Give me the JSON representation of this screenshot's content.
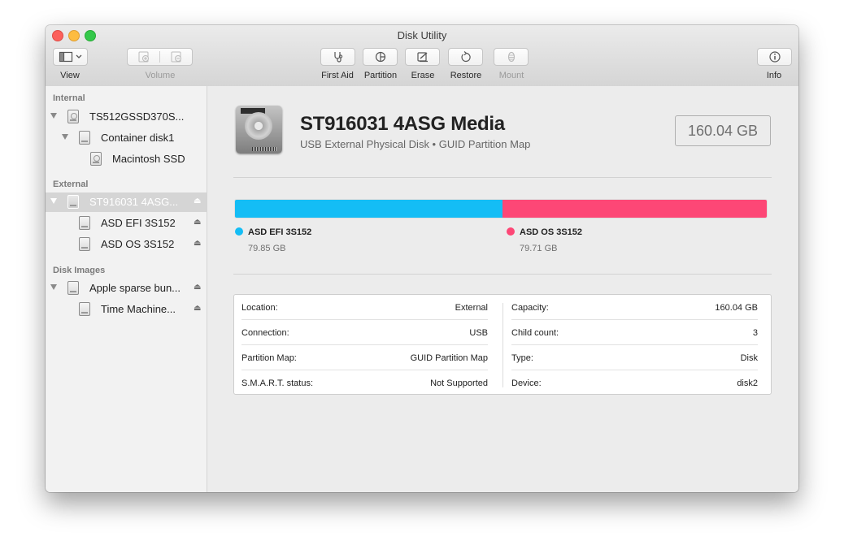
{
  "window": {
    "title": "Disk Utility"
  },
  "toolbar": {
    "view_label": "View",
    "volume_label": "Volume",
    "first_aid_label": "First Aid",
    "partition_label": "Partition",
    "erase_label": "Erase",
    "restore_label": "Restore",
    "mount_label": "Mount",
    "info_label": "Info"
  },
  "sidebar": {
    "sections": [
      {
        "header": "Internal",
        "items": [
          {
            "label": "TS512GSSD370S...",
            "level": 0,
            "icon": "internal-drive-icon",
            "disclosure": true
          },
          {
            "label": "Container disk1",
            "level": 1,
            "icon": "container-icon",
            "disclosure": true
          },
          {
            "label": "Macintosh SSD",
            "level": 2,
            "icon": "volume-icon",
            "disclosure": false
          }
        ]
      },
      {
        "header": "External",
        "items": [
          {
            "label": "ST916031 4ASG...",
            "level": 0,
            "icon": "external-drive-icon",
            "disclosure": true,
            "selected": true,
            "eject": true
          },
          {
            "label": "ASD EFI 3S152",
            "level": 1,
            "icon": "volume-icon",
            "eject": true
          },
          {
            "label": "ASD OS 3S152",
            "level": 1,
            "icon": "volume-icon",
            "eject": true
          }
        ]
      },
      {
        "header": "Disk Images",
        "items": [
          {
            "label": "Apple sparse bun...",
            "level": 0,
            "icon": "disk-image-icon",
            "disclosure": true,
            "eject": true
          },
          {
            "label": "Time Machine...",
            "level": 1,
            "icon": "volume-icon",
            "eject": true
          }
        ]
      }
    ]
  },
  "disk": {
    "name": "ST916031 4ASG Media",
    "subtitle": "USB External Physical Disk • GUID Partition Map",
    "capacity": "160.04 GB"
  },
  "partitions": [
    {
      "name": "ASD EFI 3S152",
      "size": "79.85 GB",
      "fraction": 0.5023,
      "color": "#14bdf5"
    },
    {
      "name": "ASD OS 3S152",
      "size": "79.71 GB",
      "fraction": 0.4977,
      "color": "#fd4776"
    }
  ],
  "info": {
    "left": [
      {
        "key": "Location:",
        "value": "External"
      },
      {
        "key": "Connection:",
        "value": "USB"
      },
      {
        "key": "Partition Map:",
        "value": "GUID Partition Map"
      },
      {
        "key": "S.M.A.R.T. status:",
        "value": "Not Supported"
      }
    ],
    "right": [
      {
        "key": "Capacity:",
        "value": "160.04 GB"
      },
      {
        "key": "Child count:",
        "value": "3"
      },
      {
        "key": "Type:",
        "value": "Disk"
      },
      {
        "key": "Device:",
        "value": "disk2"
      }
    ]
  }
}
